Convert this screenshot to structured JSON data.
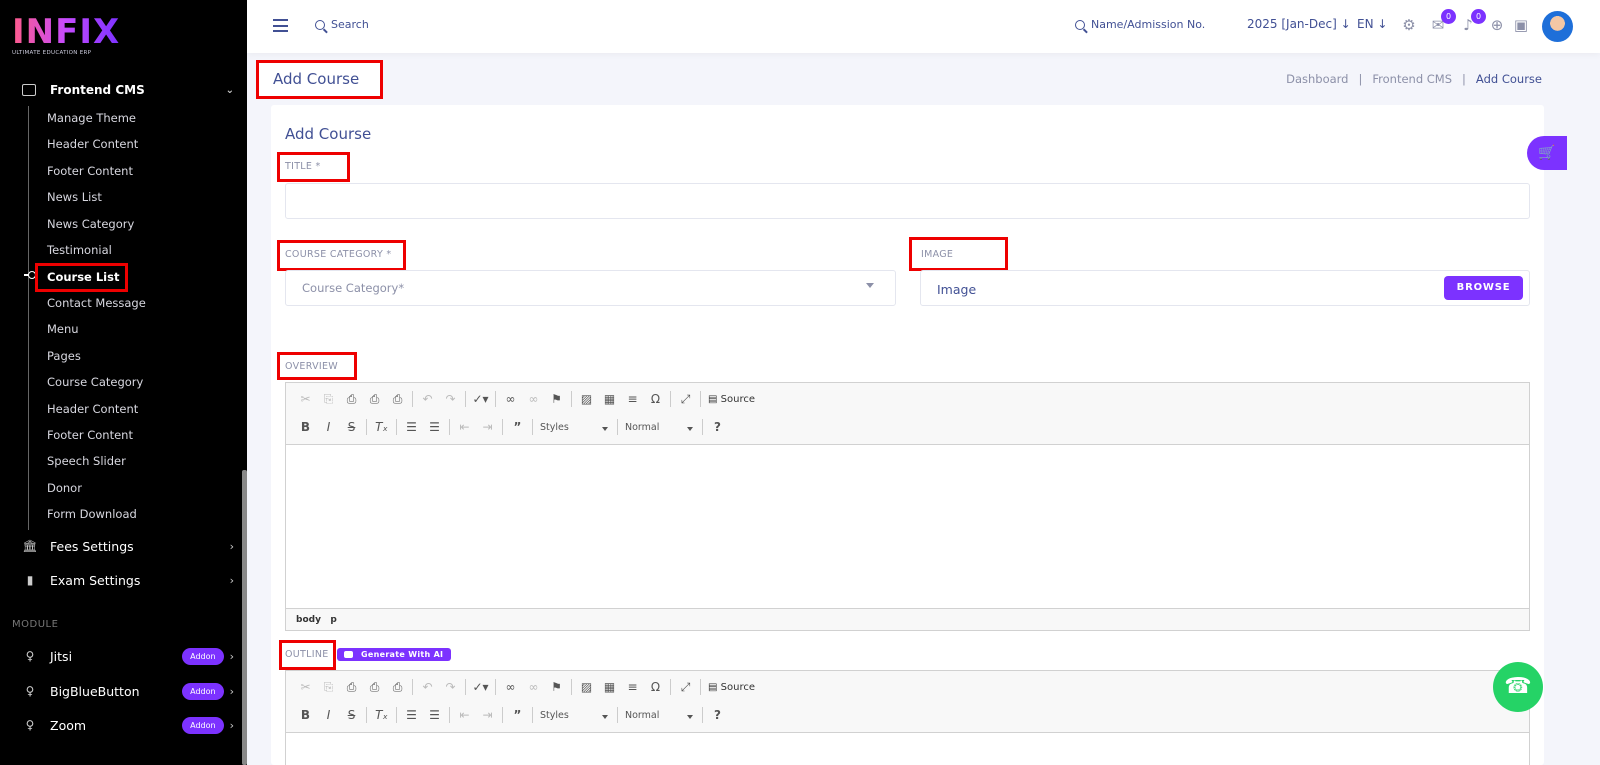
{
  "brand": {
    "name": "INFIX",
    "tagline": "ULTIMATE EDUCATION ERP"
  },
  "sidebar": {
    "section": "Frontend CMS",
    "items": [
      "Manage Theme",
      "Header Content",
      "Footer Content",
      "News List",
      "News Category",
      "Testimonial",
      "Course List",
      "Contact Message",
      "Menu",
      "Pages",
      "Course Category",
      "Header Content",
      "Footer Content",
      "Speech Slider",
      "Donor",
      "Form Download"
    ],
    "active_item": "Course List",
    "fees": "Fees Settings",
    "exam": "Exam Settings",
    "module_label": "MODULE",
    "modules": [
      {
        "label": "Jitsi",
        "badge": "Addon"
      },
      {
        "label": "BigBlueButton",
        "badge": "Addon"
      },
      {
        "label": "Zoom",
        "badge": "Addon"
      }
    ]
  },
  "topbar": {
    "search": "Search",
    "search2": "Name/Admission No.",
    "session": "2025 [Jan-Dec]",
    "lang": "EN",
    "badge_messages": "0",
    "badge_notifications": "0"
  },
  "page": {
    "title": "Add Course",
    "breadcrumb": [
      "Dashboard",
      "Frontend CMS",
      "Add Course"
    ],
    "sep": "|"
  },
  "form": {
    "card_title": "Add Course",
    "title_label": "TITLE *",
    "title_value": "",
    "category_label": "COURSE CATEGORY *",
    "category_placeholder": "Course Category*",
    "image_label": "IMAGE",
    "image_placeholder": "Image",
    "browse": "BROWSE",
    "overview_label": "OVERVIEW",
    "outline_label": "OUTLINE",
    "generate_ai": "Generate With AI"
  },
  "editor": {
    "source": "Source",
    "styles": "Styles",
    "format": "Normal",
    "path_body": "body",
    "path_p": "p",
    "help": "?"
  }
}
